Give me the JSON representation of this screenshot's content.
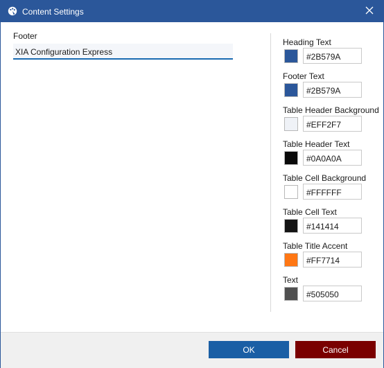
{
  "window": {
    "title": "Content Settings",
    "app_icon": "palette-icon",
    "close_icon": "close-icon",
    "titlebar_color": "#2B579A"
  },
  "footer": {
    "label": "Footer",
    "value": "XIA Configuration Express"
  },
  "colors": [
    {
      "label": "Heading Text",
      "hex": "#2B579A",
      "swatch": "#2B579A"
    },
    {
      "label": "Footer Text",
      "hex": "#2B579A",
      "swatch": "#2B579A"
    },
    {
      "label": "Table Header Background",
      "hex": "#EFF2F7",
      "swatch": "#EFF2F7"
    },
    {
      "label": "Table Header Text",
      "hex": "#0A0A0A",
      "swatch": "#0A0A0A"
    },
    {
      "label": "Table Cell Background",
      "hex": "#FFFFFF",
      "swatch": "#FFFFFF"
    },
    {
      "label": "Table Cell Text",
      "hex": "#141414",
      "swatch": "#141414"
    },
    {
      "label": "Table Title Accent",
      "hex": "#FF7714",
      "swatch": "#FF7714"
    },
    {
      "label": "Text",
      "hex": "#505050",
      "swatch": "#505050"
    }
  ],
  "buttons": {
    "ok_label": "OK",
    "cancel_label": "Cancel",
    "ok_color": "#1A5FA5",
    "cancel_color": "#7A0000"
  }
}
